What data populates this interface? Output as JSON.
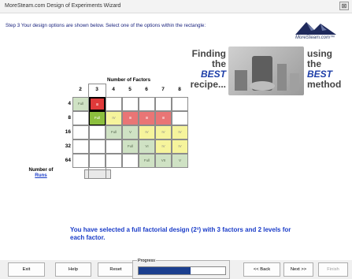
{
  "window": {
    "title": "MoreSteam.com Design of Experiments Wizard",
    "close_label": "⊠"
  },
  "step": {
    "label": "Step 3",
    "text": "Your design options are shown below.  Select one of the options within the rectangle:"
  },
  "logo": {
    "text": "MoreSteam.com™"
  },
  "banner": {
    "left": [
      "Finding",
      "the",
      "BEST",
      "recipe..."
    ],
    "right": [
      "using",
      "the",
      "BEST",
      "method"
    ]
  },
  "grid": {
    "factors_label": "Number of Factors",
    "runs_label_1": "Number of",
    "runs_label_2": "Runs",
    "columns": [
      "2",
      "3",
      "4",
      "5",
      "6",
      "7",
      "8"
    ],
    "rows": [
      {
        "runs": "4",
        "cells": [
          {
            "t": "Full",
            "s": "gray"
          },
          {
            "t": "III",
            "s": "red"
          },
          {
            "t": "",
            "s": "empty"
          },
          {
            "t": "",
            "s": "empty"
          },
          {
            "t": "",
            "s": "empty"
          },
          {
            "t": "",
            "s": "empty"
          },
          {
            "t": "",
            "s": "empty"
          }
        ]
      },
      {
        "runs": "8",
        "cells": [
          {
            "t": "",
            "s": "empty"
          },
          {
            "t": "Full",
            "s": "green"
          },
          {
            "t": "IV",
            "s": "yellow"
          },
          {
            "t": "III",
            "s": "red2"
          },
          {
            "t": "III",
            "s": "red2"
          },
          {
            "t": "III",
            "s": "red2"
          },
          {
            "t": "",
            "s": "empty"
          }
        ]
      },
      {
        "runs": "16",
        "cells": [
          {
            "t": "",
            "s": "empty"
          },
          {
            "t": "",
            "s": "empty"
          },
          {
            "t": "Full",
            "s": "gray"
          },
          {
            "t": "V",
            "s": "gray"
          },
          {
            "t": "IV",
            "s": "yellow"
          },
          {
            "t": "IV",
            "s": "yellow"
          },
          {
            "t": "IV",
            "s": "yellow"
          }
        ]
      },
      {
        "runs": "32",
        "cells": [
          {
            "t": "",
            "s": "empty"
          },
          {
            "t": "",
            "s": "empty"
          },
          {
            "t": "",
            "s": "empty"
          },
          {
            "t": "Full",
            "s": "gray"
          },
          {
            "t": "VI",
            "s": "gray"
          },
          {
            "t": "IV",
            "s": "yellow"
          },
          {
            "t": "IV",
            "s": "yellow"
          }
        ]
      },
      {
        "runs": "64",
        "cells": [
          {
            "t": "",
            "s": "empty"
          },
          {
            "t": "",
            "s": "empty"
          },
          {
            "t": "",
            "s": "empty"
          },
          {
            "t": "",
            "s": "empty"
          },
          {
            "t": "Full",
            "s": "gray"
          },
          {
            "t": "VII",
            "s": "gray"
          },
          {
            "t": "V",
            "s": "gray"
          }
        ]
      }
    ]
  },
  "message": "You have selected a full factorial design (2³) with 3 factors and 2 levels for each factor.",
  "footer": {
    "exit": "Exit",
    "help": "Help",
    "reset": "Reset",
    "progress_label": "Progress",
    "progress_value": 0.6,
    "back": "<< Back",
    "next": "Next >>",
    "finish": "Finish"
  }
}
